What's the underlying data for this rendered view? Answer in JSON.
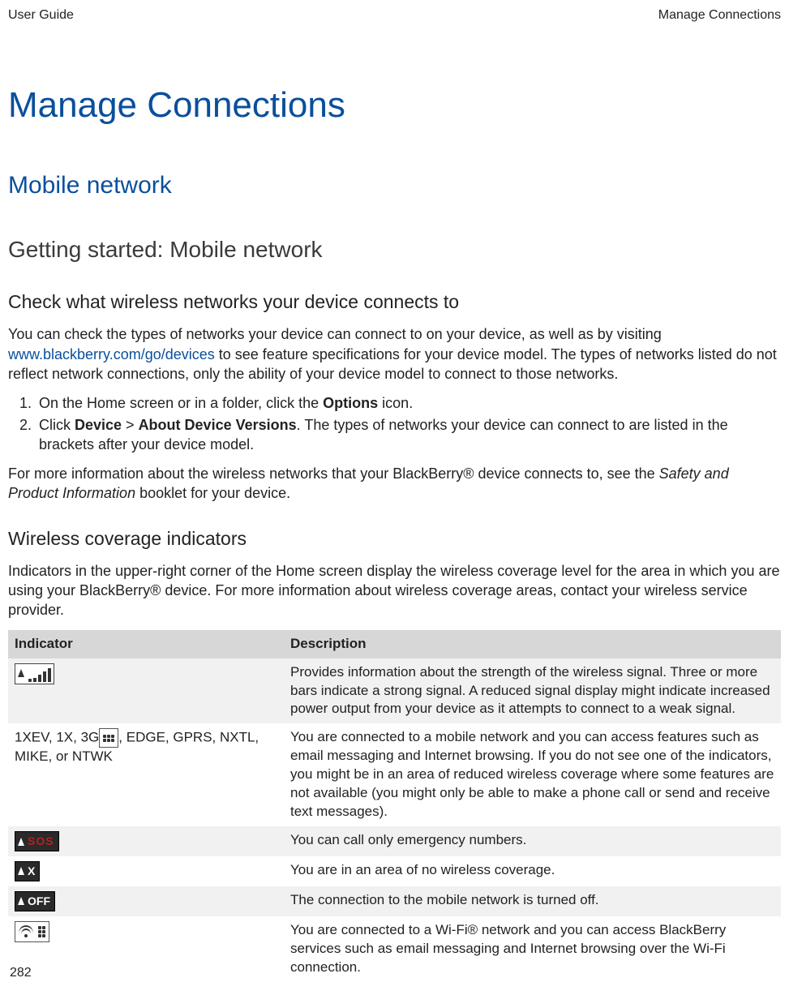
{
  "header": {
    "left": "User Guide",
    "right": "Manage Connections"
  },
  "h1": "Manage Connections",
  "h2": "Mobile network",
  "h3": "Getting started: Mobile network",
  "sec1": {
    "heading": "Check what wireless networks your device connects to",
    "intro_pre": "You can check the types of networks your device can connect to on your device, as well as by visiting ",
    "intro_link": "www.blackberry.com/go/devices",
    "intro_post": " to see feature specifications for your device model. The types of networks listed do not reflect network connections, only the ability of your device model to connect to those networks.",
    "step1_pre": "On the Home screen or in a folder, click the ",
    "step1_bold": "Options",
    "step1_post": " icon.",
    "step2_pre": "Click ",
    "step2_b1": "Device",
    "step2_gt": " > ",
    "step2_b2": "About Device Versions",
    "step2_post": ". The types of networks your device can connect to are listed in the brackets after your device model.",
    "footer_pre": "For more information about the wireless networks that your BlackBerry® device connects to, see the ",
    "footer_italic": "Safety and Product Information",
    "footer_post": " booklet for your device."
  },
  "sec2": {
    "heading": "Wireless coverage indicators",
    "intro": "Indicators in the upper-right corner of the Home screen display the wireless coverage level for the area in which you are using your BlackBerry® device. For more information about wireless coverage areas, contact your wireless service provider."
  },
  "table": {
    "col1": "Indicator",
    "col2": "Description",
    "rows": [
      {
        "icon": "signal-strength",
        "label": "",
        "desc": "Provides information about the strength of the wireless signal. Three or more bars indicate a strong signal. A reduced signal display might indicate increased power output from your device as it attempts to connect to a weak signal."
      },
      {
        "icon": "bb-dots",
        "label_pre": "1XEV, 1X, 3G",
        "label_post": ", EDGE, GPRS, NXTL, MIKE, or NTWK",
        "desc": "You are connected to a mobile network and you can access features such as email messaging and Internet browsing. If you do not see one of the indicators, you might be in an area of reduced wireless coverage where some features are not available (you might only be able to make a phone call or send and receive text messages)."
      },
      {
        "icon": "sos",
        "label": "",
        "sos_text": "SOS",
        "desc": "You can call only emergency numbers."
      },
      {
        "icon": "x",
        "label": "",
        "x_text": "X",
        "desc": "You are in an area of no wireless coverage."
      },
      {
        "icon": "off",
        "label": "",
        "off_text": "OFF",
        "desc": "The connection to the mobile network is turned off."
      },
      {
        "icon": "wifi-bb",
        "label": "",
        "desc": "You are connected to a Wi-Fi® network and you can access BlackBerry services such as email messaging and Internet browsing over the Wi-Fi connection."
      }
    ]
  },
  "page_number": "282"
}
